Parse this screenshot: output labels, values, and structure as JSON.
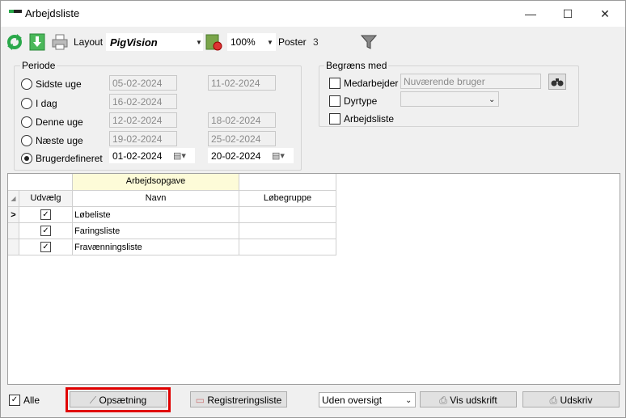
{
  "window": {
    "title": "Arbejdsliste",
    "minimize": "—",
    "maximize": "☐",
    "close": "✕"
  },
  "toolbar": {
    "layout_label": "Layout",
    "layout_value": "PigVision",
    "zoom": "100%",
    "poster_label": "Poster",
    "poster_value": "3"
  },
  "periode": {
    "label": "Periode",
    "rows": [
      {
        "label": "Sidste uge",
        "from": "05-02-2024",
        "to": "11-02-2024",
        "selected": false
      },
      {
        "label": "I dag",
        "from": "16-02-2024",
        "to": "",
        "selected": false
      },
      {
        "label": "Denne uge",
        "from": "12-02-2024",
        "to": "18-02-2024",
        "selected": false
      },
      {
        "label": "Næste uge",
        "from": "19-02-2024",
        "to": "25-02-2024",
        "selected": false
      },
      {
        "label": "Brugerdefineret",
        "from": "01-02-2024",
        "to": "20-02-2024",
        "selected": true
      }
    ]
  },
  "begraens": {
    "label": "Begræns med",
    "medarbejder_label": "Medarbejder",
    "medarbejder_value": "Nuværende bruger",
    "dyrtype_label": "Dyrtype",
    "dyrtype_value": "",
    "arbejdsliste_label": "Arbejdsliste"
  },
  "grid": {
    "band_header": "Arbejdsopgave",
    "columns": [
      "Udvælg",
      "Navn",
      "Løbegruppe"
    ],
    "rows": [
      {
        "checked": true,
        "navn": "Løbeliste",
        "lobegruppe": ""
      },
      {
        "checked": true,
        "navn": "Faringsliste",
        "lobegruppe": ""
      },
      {
        "checked": true,
        "navn": "Fravænningsliste",
        "lobegruppe": ""
      }
    ]
  },
  "bottom": {
    "alle_label": "Alle",
    "opsaetning": "Opsætning",
    "registreringsliste": "Registreringsliste",
    "oversigt": "Uden oversigt",
    "vis_udskrift": "Vis udskrift",
    "udskriv": "Udskriv"
  },
  "colors": {
    "highlight": "#e00000",
    "band": "#fdfbd8",
    "accent_green": "#2aa84a"
  }
}
